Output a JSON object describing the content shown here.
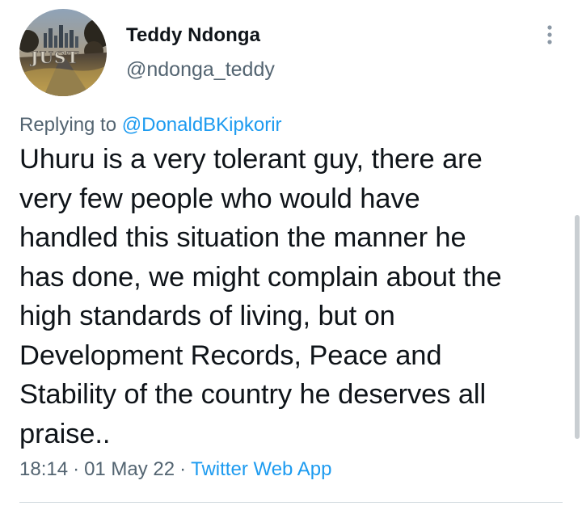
{
  "author": {
    "display_name": "Teddy Ndonga",
    "handle": "@ndonga_teddy",
    "avatar_text": "JUST",
    "avatar_icon": "profile-photo"
  },
  "reply": {
    "prefix": "Replying to ",
    "to_handle": "@DonaldBKipkorir"
  },
  "tweet": {
    "text": "Uhuru is a very tolerant guy, there are\nvery few people who would have\nhandled this situation the manner he\nhas done, we might complain about the\nhigh standards of living, but on\nDevelopment Records, Peace and\nStability of the country he deserves all\npraise.."
  },
  "meta": {
    "time": "18:14",
    "date": "01 May 22",
    "separator": "·",
    "source": "Twitter Web App"
  },
  "icons": {
    "more": "more-vertical-icon"
  },
  "colors": {
    "text_primary": "#0f1419",
    "text_secondary": "#536471",
    "link": "#1d9bf0",
    "divider": "#cfd9de"
  }
}
